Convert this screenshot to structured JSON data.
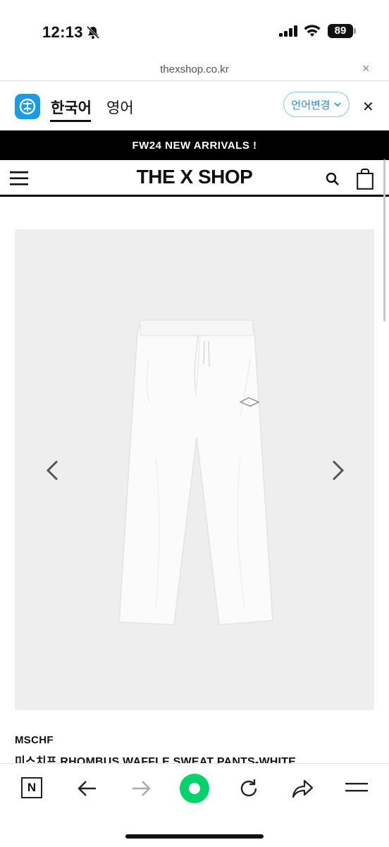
{
  "status_bar": {
    "time": "12:13",
    "battery": "89"
  },
  "browser": {
    "url": "thexshop.co.kr",
    "close_icon": "×"
  },
  "translate": {
    "lang_source": "한국어",
    "lang_target": "영어",
    "change_label": "언어변경",
    "close_icon": "✕",
    "accent": "#1a9be8"
  },
  "site": {
    "announcement": "FW24 NEW ARRIVALS !",
    "logo": "THE X SHOP"
  },
  "product": {
    "brand": "MSCHF",
    "name": "미스치프 RHOMBUS WAFFLE SWEAT PANTS-WHITE"
  },
  "toolbar": {
    "n_label": "N",
    "home_color": "#03d46a"
  }
}
